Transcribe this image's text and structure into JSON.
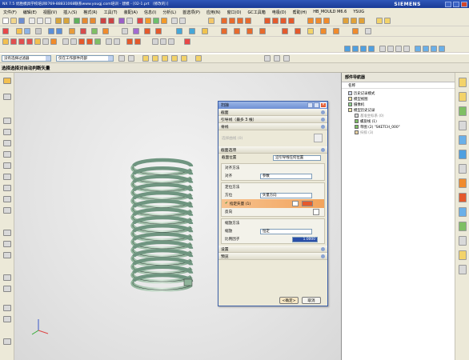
{
  "window": {
    "title": "NX 7.5 优胜模具学校培训0769-88831068联系www.yougj.com培训 - 建模 - [02-1.prt （修改的）]",
    "brand": "SIEMENS"
  },
  "menu": [
    "文件(F)",
    "编辑(E)",
    "视图(V)",
    "插入(S)",
    "格式(R)",
    "工具(T)",
    "装配(A)",
    "信息(I)",
    "分析(L)",
    "首选项(P)",
    "应用(N)",
    "窗口(O)",
    "GC工具箱",
    "电极(D)",
    "帮助(H)",
    "HB_MOULD M6.6",
    "YSUG"
  ],
  "filter": {
    "type_filter": "没有选择过滤器",
    "scope": "仅在工作部件内部"
  },
  "cue": "选择选择对自动判断矢量",
  "dialog": {
    "title": "扫掠",
    "sections": {
      "section": "截面",
      "guide": "引导线（最多 3 根）",
      "spine": "脊线",
      "spine_select": "选择曲线 (0)",
      "section_options": "截面选项",
      "section_position_label": "截面位置",
      "section_position_value": "沿引导线任何位置",
      "alignment_method": "对齐方法",
      "alignment_label": "对齐",
      "alignment_value": "参数",
      "orientation_method": "定位方法",
      "orientation_label": "方位",
      "orientation_value": "矢量方向",
      "specify_vector": "指定矢量 (1)",
      "reverse": "反向",
      "scaling_method": "缩放方法",
      "scaling_label": "缩放",
      "scaling_value": "恒定",
      "scale_factor_label": "比例因子",
      "scale_factor_value": "1.0000",
      "settings": "设置",
      "preview": "预览"
    },
    "buttons": {
      "ok": "<确定>",
      "cancel": "取消"
    }
  },
  "navigator": {
    "title": "部件导航器",
    "column": "名称",
    "items": [
      {
        "label": "历史记录模式",
        "state": "normal"
      },
      {
        "label": "模型视图",
        "state": "normal"
      },
      {
        "label": "摄像机",
        "state": "normal"
      },
      {
        "label": "模型历史记录",
        "state": "normal"
      },
      {
        "label": "基准坐标系 (0)",
        "state": "gray"
      },
      {
        "label": "螺旋线 (1)",
        "state": "normal"
      },
      {
        "label": "草图 (2) \"SKETCH_000\"",
        "state": "normal"
      },
      {
        "label": "扫掠 (3)",
        "state": "gray"
      }
    ]
  }
}
